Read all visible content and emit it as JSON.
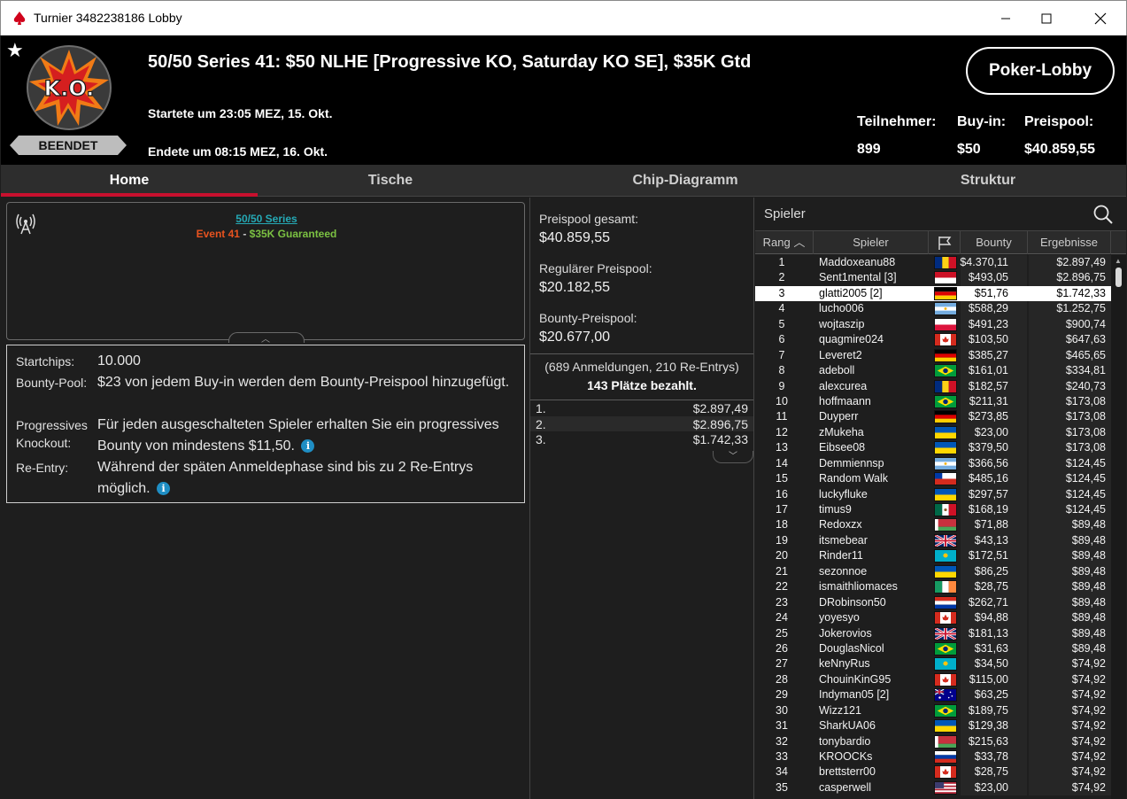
{
  "window": {
    "title": "Turnier 3482238186 Lobby",
    "logo_icon": "pokerstars-spade-icon",
    "minimize_icon": "minimize-icon",
    "maximize_icon": "maximize-icon",
    "close_icon": "close-icon"
  },
  "header": {
    "favorite_icon": "star-icon",
    "logo_text": "K.O.",
    "status": "BEENDET",
    "title": "50/50 Series 41: $50 NLHE [Progressive KO, Saturday KO SE], $35K Gtd",
    "started": "Startete um 23:05 MEZ, 15. Okt.",
    "ended": "Endete um 08:15 MEZ, 16. Okt.",
    "lobby_button": "Poker-Lobby",
    "stats": [
      {
        "label": "Teilnehmer:",
        "value": "899"
      },
      {
        "label": "Buy-in:",
        "value": "$50"
      },
      {
        "label": "Preispool:",
        "value": "$40.859,55"
      }
    ]
  },
  "tabs": [
    {
      "label": "Home",
      "active": true
    },
    {
      "label": "Tische",
      "active": false
    },
    {
      "label": "Chip-Diagramm",
      "active": false
    },
    {
      "label": "Struktur",
      "active": false
    }
  ],
  "info": {
    "series_link": "50/50 Series",
    "event": "Event 41",
    "separator": " - ",
    "guarantee": "$35K Guaranteed",
    "details": [
      {
        "label": "Startchips:",
        "value": "10.000"
      },
      {
        "label": "Bounty-Pool:",
        "value": "$23 von jedem Buy-in werden dem Bounty-Preispool hinzugefügt."
      },
      {
        "label": "Progressives Knockout:",
        "value": "Für jeden ausgeschalteten Spieler erhalten Sie ein progressives Bounty von mindestens $11,50."
      },
      {
        "label": "Re-Entry:",
        "value": "Während der späten Anmeldephase sind bis zu 2 Re-Entrys möglich."
      }
    ]
  },
  "prizepool": {
    "total_label": "Preispool gesamt:",
    "total_value": "$40.859,55",
    "regular_label": "Regulärer Preispool:",
    "regular_value": "$20.182,55",
    "bounty_label": "Bounty-Preispool:",
    "bounty_value": "$20.677,00",
    "registrations": "(689 Anmeldungen, 210 Re-Entrys)",
    "paid": "143 Plätze bezahlt.",
    "payouts": [
      {
        "pos": "1.",
        "amount": "$2.897,49"
      },
      {
        "pos": "2.",
        "amount": "$2.896,75"
      },
      {
        "pos": "3.",
        "amount": "$1.742,33"
      }
    ]
  },
  "players": {
    "search_label": "Spieler",
    "columns": {
      "rank": "Rang",
      "player": "Spieler",
      "bounty": "Bounty",
      "results": "Ergebnisse"
    },
    "selected_rank": "3",
    "rows": [
      {
        "rank": "1",
        "name": "Maddoxeanu88",
        "flag": "ro",
        "bounty": "$4.370,11",
        "result": "$2.897,49"
      },
      {
        "rank": "2",
        "name": "Sent1mental [3]",
        "flag": "id",
        "bounty": "$493,05",
        "result": "$2.896,75"
      },
      {
        "rank": "3",
        "name": "glatti2005 [2]",
        "flag": "de",
        "bounty": "$51,76",
        "result": "$1.742,33"
      },
      {
        "rank": "4",
        "name": "lucho006",
        "flag": "ar",
        "bounty": "$588,29",
        "result": "$1.252,75"
      },
      {
        "rank": "5",
        "name": "wojtaszip",
        "flag": "pl",
        "bounty": "$491,23",
        "result": "$900,74"
      },
      {
        "rank": "6",
        "name": "quagmire024",
        "flag": "ca",
        "bounty": "$103,50",
        "result": "$647,63"
      },
      {
        "rank": "7",
        "name": "Leveret2",
        "flag": "de",
        "bounty": "$385,27",
        "result": "$465,65"
      },
      {
        "rank": "8",
        "name": "adeboll",
        "flag": "br",
        "bounty": "$161,01",
        "result": "$334,81"
      },
      {
        "rank": "9",
        "name": "alexcurea",
        "flag": "ro",
        "bounty": "$182,57",
        "result": "$240,73"
      },
      {
        "rank": "10",
        "name": "hoffmaann",
        "flag": "br",
        "bounty": "$211,31",
        "result": "$173,08"
      },
      {
        "rank": "11",
        "name": "Duyperr",
        "flag": "de",
        "bounty": "$273,85",
        "result": "$173,08"
      },
      {
        "rank": "12",
        "name": "zMukeha",
        "flag": "ua",
        "bounty": "$23,00",
        "result": "$173,08"
      },
      {
        "rank": "13",
        "name": "Eibsee08",
        "flag": "ua",
        "bounty": "$379,50",
        "result": "$173,08"
      },
      {
        "rank": "14",
        "name": "Demmiennsp",
        "flag": "ar",
        "bounty": "$366,56",
        "result": "$124,45"
      },
      {
        "rank": "15",
        "name": "Random Walk",
        "flag": "cl",
        "bounty": "$485,16",
        "result": "$124,45"
      },
      {
        "rank": "16",
        "name": "luckyfluke",
        "flag": "ua",
        "bounty": "$297,57",
        "result": "$124,45"
      },
      {
        "rank": "17",
        "name": "timus9",
        "flag": "mx",
        "bounty": "$168,19",
        "result": "$124,45"
      },
      {
        "rank": "18",
        "name": "Redoxzx",
        "flag": "by",
        "bounty": "$71,88",
        "result": "$89,48"
      },
      {
        "rank": "19",
        "name": "itsmebear",
        "flag": "gb",
        "bounty": "$43,13",
        "result": "$89,48"
      },
      {
        "rank": "20",
        "name": "Rinder11",
        "flag": "kz",
        "bounty": "$172,51",
        "result": "$89,48"
      },
      {
        "rank": "21",
        "name": "sezonnoe",
        "flag": "ua",
        "bounty": "$86,25",
        "result": "$89,48"
      },
      {
        "rank": "22",
        "name": "ismaithliomaces",
        "flag": "ie",
        "bounty": "$28,75",
        "result": "$89,48"
      },
      {
        "rank": "23",
        "name": "DRobinson50",
        "flag": "py",
        "bounty": "$262,71",
        "result": "$89,48"
      },
      {
        "rank": "24",
        "name": "yoyesyo",
        "flag": "ca",
        "bounty": "$94,88",
        "result": "$89,48"
      },
      {
        "rank": "25",
        "name": "Jokerovios",
        "flag": "gb",
        "bounty": "$181,13",
        "result": "$89,48"
      },
      {
        "rank": "26",
        "name": "DouglasNicol",
        "flag": "br",
        "bounty": "$31,63",
        "result": "$89,48"
      },
      {
        "rank": "27",
        "name": "keNnyRus",
        "flag": "kz",
        "bounty": "$34,50",
        "result": "$74,92"
      },
      {
        "rank": "28",
        "name": "ChouinKinG95",
        "flag": "ca",
        "bounty": "$115,00",
        "result": "$74,92"
      },
      {
        "rank": "29",
        "name": "Indyman05 [2]",
        "flag": "au",
        "bounty": "$63,25",
        "result": "$74,92"
      },
      {
        "rank": "30",
        "name": "Wizz121",
        "flag": "br",
        "bounty": "$189,75",
        "result": "$74,92"
      },
      {
        "rank": "31",
        "name": "SharkUA06",
        "flag": "ua",
        "bounty": "$129,38",
        "result": "$74,92"
      },
      {
        "rank": "32",
        "name": "tonybardio",
        "flag": "by",
        "bounty": "$215,63",
        "result": "$74,92"
      },
      {
        "rank": "33",
        "name": "KROOCKs",
        "flag": "ru",
        "bounty": "$33,78",
        "result": "$74,92"
      },
      {
        "rank": "34",
        "name": "brettsterr00",
        "flag": "ca",
        "bounty": "$28,75",
        "result": "$74,92"
      },
      {
        "rank": "35",
        "name": "casperwell",
        "flag": "us",
        "bounty": "$23,00",
        "result": "$74,92"
      }
    ]
  }
}
